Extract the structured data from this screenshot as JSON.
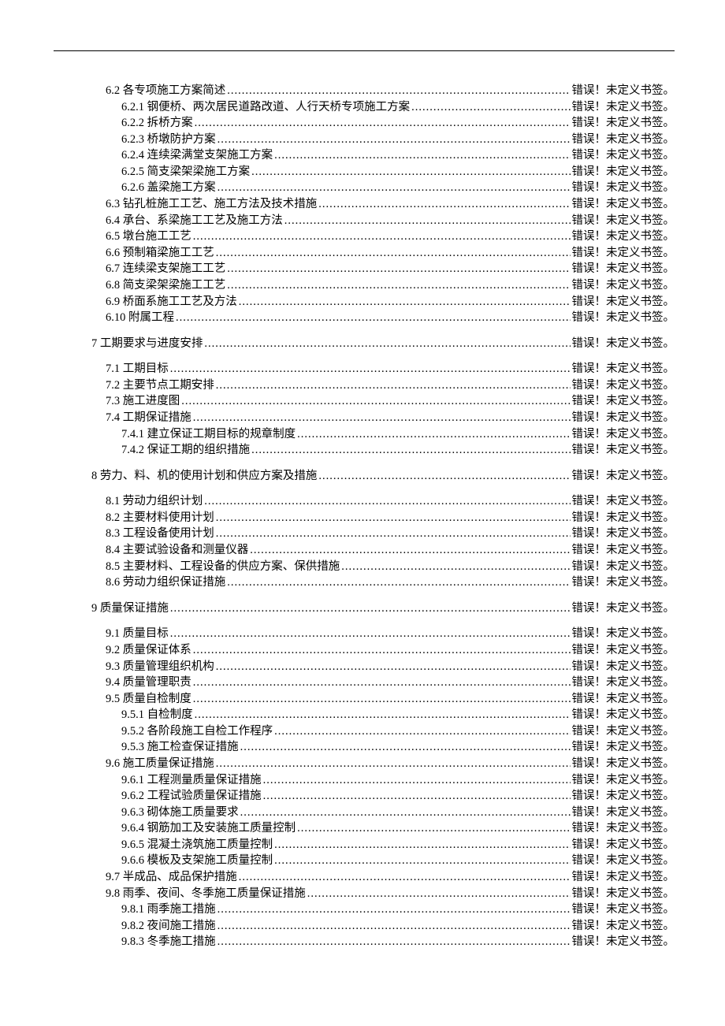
{
  "error_text": "错误！未定义书签。",
  "entries": [
    {
      "indent": 1,
      "label": "6.2 各专项施工方案简述",
      "group": 0
    },
    {
      "indent": 2,
      "label": "6.2.1 钢便桥、两次居民道路改道、人行天桥专项施工方案",
      "group": 0
    },
    {
      "indent": 2,
      "label": "6.2.2 拆桥方案",
      "group": 0
    },
    {
      "indent": 2,
      "label": "6.2.3 桥墩防护方案",
      "group": 0
    },
    {
      "indent": 2,
      "label": "6.2.4 连续梁满堂支架施工方案",
      "group": 0
    },
    {
      "indent": 2,
      "label": "6.2.5 简支梁架梁施工方案",
      "group": 0
    },
    {
      "indent": 2,
      "label": "6.2.6 盖梁施工方案",
      "group": 0
    },
    {
      "indent": 1,
      "label": "6.3 钻孔桩施工工艺、施工方法及技术措施",
      "group": 0
    },
    {
      "indent": 1,
      "label": "6.4 承台、系梁施工工艺及施工方法",
      "group": 0
    },
    {
      "indent": 1,
      "label": "6.5 墩台施工工艺",
      "group": 0
    },
    {
      "indent": 1,
      "label": "6.6 预制箱梁施工工艺",
      "group": 0
    },
    {
      "indent": 1,
      "label": "6.7 连续梁支架施工工艺",
      "group": 0
    },
    {
      "indent": 1,
      "label": "6.8 简支梁架梁施工工艺",
      "group": 0
    },
    {
      "indent": 1,
      "label": "6.9 桥面系施工工艺及方法",
      "group": 0
    },
    {
      "indent": 1,
      "label": "6.10 附属工程",
      "group": 0
    },
    {
      "indent": 0,
      "label": "7 工期要求与进度安排",
      "group": 1
    },
    {
      "indent": 1,
      "label": "7.1 工期目标",
      "group": 2
    },
    {
      "indent": 1,
      "label": "7.2 主要节点工期安排",
      "group": 2
    },
    {
      "indent": 1,
      "label": "7.3 施工进度图",
      "group": 2
    },
    {
      "indent": 1,
      "label": "7.4 工期保证措施",
      "group": 2
    },
    {
      "indent": 2,
      "label": "7.4.1 建立保证工期目标的规章制度",
      "group": 2
    },
    {
      "indent": 2,
      "label": "7.4.2 保证工期的组织措施",
      "group": 2
    },
    {
      "indent": 0,
      "label": "8 劳力、料、机的使用计划和供应方案及措施",
      "group": 3
    },
    {
      "indent": 1,
      "label": "8.1 劳动力组织计划",
      "group": 4
    },
    {
      "indent": 1,
      "label": "8.2 主要材料使用计划",
      "group": 4
    },
    {
      "indent": 1,
      "label": "8.3 工程设备使用计划",
      "group": 4
    },
    {
      "indent": 1,
      "label": "8.4 主要试验设备和测量仪器",
      "group": 4
    },
    {
      "indent": 1,
      "label": "8.5 主要材料、工程设备的供应方案、保供措施",
      "group": 4
    },
    {
      "indent": 1,
      "label": "8.6 劳动力组织保证措施",
      "group": 4
    },
    {
      "indent": 0,
      "label": "9 质量保证措施",
      "group": 5
    },
    {
      "indent": 1,
      "label": "9.1 质量目标",
      "group": 6
    },
    {
      "indent": 1,
      "label": "9.2 质量保证体系",
      "group": 6
    },
    {
      "indent": 1,
      "label": "9.3 质量管理组织机构",
      "group": 6
    },
    {
      "indent": 1,
      "label": "9.4 质量管理职责",
      "group": 6
    },
    {
      "indent": 1,
      "label": "9.5 质量自检制度",
      "group": 6
    },
    {
      "indent": 2,
      "label": "9.5.1 自检制度",
      "group": 6
    },
    {
      "indent": 2,
      "label": "9.5.2 各阶段施工自检工作程序",
      "group": 6
    },
    {
      "indent": 2,
      "label": "9.5.3 施工检查保证措施",
      "group": 6
    },
    {
      "indent": 1,
      "label": "9.6 施工质量保证措施",
      "group": 6
    },
    {
      "indent": 2,
      "label": "9.6.1 工程测量质量保证措施",
      "group": 6
    },
    {
      "indent": 2,
      "label": "9.6.2 工程试验质量保证措施",
      "group": 6
    },
    {
      "indent": 2,
      "label": "9.6.3 砌体施工质量要求",
      "group": 6
    },
    {
      "indent": 2,
      "label": "9.6.4 钢筋加工及安装施工质量控制",
      "group": 6
    },
    {
      "indent": 2,
      "label": "9.6.5 混凝土浇筑施工质量控制",
      "group": 6
    },
    {
      "indent": 2,
      "label": "9.6.6 模板及支架施工质量控制",
      "group": 6
    },
    {
      "indent": 1,
      "label": "9.7 半成品、成品保护措施",
      "group": 6
    },
    {
      "indent": 1,
      "label": "9.8 雨季、夜间、冬季施工质量保证措施",
      "group": 6
    },
    {
      "indent": 2,
      "label": "9.8.1 雨季施工措施",
      "group": 6
    },
    {
      "indent": 2,
      "label": "9.8.2 夜间施工措施",
      "group": 6
    },
    {
      "indent": 2,
      "label": "9.8.3 冬季施工措施",
      "group": 6
    }
  ]
}
